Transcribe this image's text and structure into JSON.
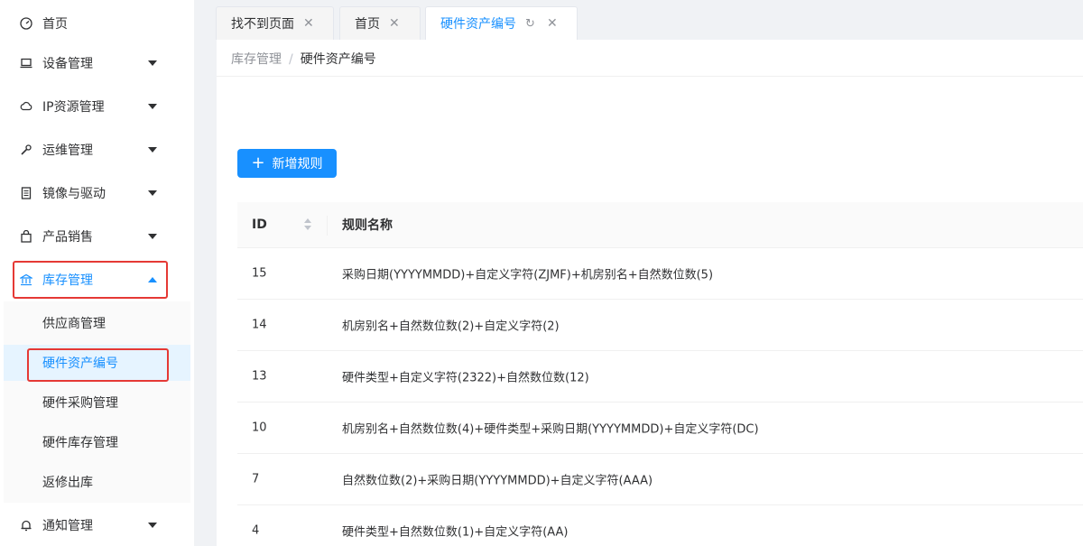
{
  "sidebar": {
    "items": [
      {
        "label": "首页",
        "icon": "dashboard-icon"
      },
      {
        "label": "设备管理",
        "icon": "laptop-icon"
      },
      {
        "label": "IP资源管理",
        "icon": "cloud-icon"
      },
      {
        "label": "运维管理",
        "icon": "wrench-icon"
      },
      {
        "label": "镜像与驱动",
        "icon": "file-icon"
      },
      {
        "label": "产品销售",
        "icon": "shopping-icon"
      },
      {
        "label": "库存管理",
        "icon": "bank-icon"
      },
      {
        "label": "通知管理",
        "icon": "bell-icon"
      }
    ],
    "sub_items": [
      {
        "label": "供应商管理"
      },
      {
        "label": "硬件资产编号"
      },
      {
        "label": "硬件采购管理"
      },
      {
        "label": "硬件库存管理"
      },
      {
        "label": "返修出库"
      }
    ]
  },
  "tabs": [
    {
      "label": "找不到页面"
    },
    {
      "label": "首页"
    },
    {
      "label": "硬件资产编号"
    }
  ],
  "breadcrumb": {
    "parent": "库存管理",
    "separator": "/",
    "current": "硬件资产编号"
  },
  "toolbar": {
    "add_label": "新增规则"
  },
  "table": {
    "columns": {
      "id": "ID",
      "name": "规则名称"
    },
    "rows": [
      {
        "id": "15",
        "name": "采购日期(YYYYMMDD)+自定义字符(ZJMF)+机房别名+自然数位数(5)"
      },
      {
        "id": "14",
        "name": "机房别名+自然数位数(2)+自定义字符(2)"
      },
      {
        "id": "13",
        "name": "硬件类型+自定义字符(2322)+自然数位数(12)"
      },
      {
        "id": "10",
        "name": "机房别名+自然数位数(4)+硬件类型+采购日期(YYYYMMDD)+自定义字符(DC)"
      },
      {
        "id": "7",
        "name": "自然数位数(2)+采购日期(YYYYMMDD)+自定义字符(AAA)"
      },
      {
        "id": "4",
        "name": "硬件类型+自然数位数(1)+自定义字符(AA)"
      }
    ]
  },
  "colors": {
    "accent": "#1890ff",
    "highlight": "#e53935"
  }
}
